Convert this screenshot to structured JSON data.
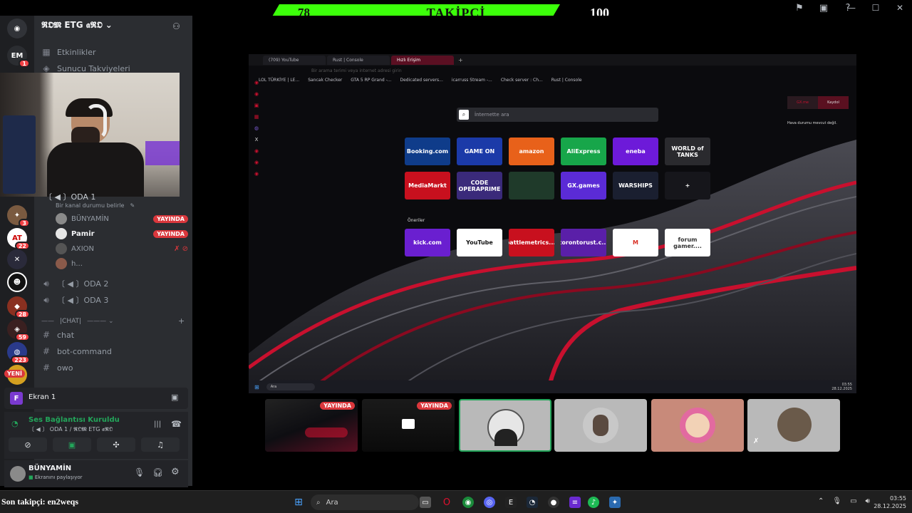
{
  "overlay": {
    "follow_left": "78",
    "follow_title": "TAKİPÇİ",
    "follow_right": "100",
    "last_follower": "Son takipçi: en2weqs"
  },
  "discord": {
    "server_name": "𝕽𝕺𝕸 ETG 𝖆𝕽𝕺",
    "events": "Etkinlikler",
    "boosts": "Sunucu Takviyeleri",
    "voice_room": "〔 ◀ 〕ODA 1",
    "channel_status": "Bir kanal durumu belirle",
    "voice_users": [
      {
        "name": "BÜNYAMİN",
        "live": "YAYINDA"
      },
      {
        "name": "Pamir",
        "live": "YAYINDA"
      },
      {
        "name": "AXION",
        "live": ""
      },
      {
        "name": "h...",
        "live": ""
      }
    ],
    "rooms": [
      "〔 ◀ 〕ODA 2",
      "〔 ◀ 〕ODA 3"
    ],
    "chat_category": "|CHAT|",
    "text_channels": [
      "chat",
      "bot-command",
      "owo"
    ],
    "screen_label": "Ekran 1",
    "voice_status": "Ses Bağlantısı Kuruldu",
    "voice_sub": "〔 ◀ 〕 ODA 1 / 𝕽𝕺𝕸 ETG 𝖆𝕽𝕺",
    "user_name": "BÜNYAMİN",
    "user_status": "Ekranını paylaşıyor",
    "rail_badges": [
      "1",
      "3",
      "22",
      "28",
      "59",
      "223"
    ],
    "rail_new": "YENİ",
    "tile_live": "YAYINDA"
  },
  "browser": {
    "tabs": [
      "(709) YouTube",
      "Rust | Console",
      "Hızlı Erişim"
    ],
    "address_placeholder": "Bir arama terimi veya internet adresi girin",
    "bookmarks": [
      "LOL TÜRKİYE | LE...",
      "Sancak Checker",
      "GTA 5 RP Grand -...",
      "Dedicated servers...",
      "icarruss Stream -...",
      "Check server : Ch...",
      "Rust | Console"
    ],
    "search_placeholder": "İnternette ara",
    "speed_dial": [
      {
        "label": "Booking.com",
        "color": "#0f3c8a"
      },
      {
        "label": "GAME ON",
        "color": "#1b3aa8"
      },
      {
        "label": "amazon",
        "color": "#e8611a"
      },
      {
        "label": "AliExpress",
        "color": "#17a64a"
      },
      {
        "label": "eneba",
        "color": "#6d1ad9"
      },
      {
        "label": "WORLD of TANKS",
        "color": "#2a2a2e"
      },
      {
        "label": "MediaMarkt",
        "color": "#c8101e"
      },
      {
        "label": "CODE OPERAPRIME",
        "color": "#3a2a7a"
      },
      {
        "label": "",
        "color": "#1f3a2a"
      },
      {
        "label": "GX.games",
        "color": "#5b2bd6"
      },
      {
        "label": "WARSHIPS",
        "color": "#1a1f30"
      },
      {
        "label": "+",
        "color": "#16161b"
      }
    ],
    "suggestions_label": "Öneriler",
    "suggestions": [
      {
        "label": "kick.com",
        "color": "#6a1fd0"
      },
      {
        "label": "YouTube",
        "color": "#ffffff"
      },
      {
        "label": "battlemetrics....",
        "color": "#c8101e"
      },
      {
        "label": "torontorust.c...",
        "color": "#5a1fa8"
      },
      {
        "label": "M",
        "color": "#ffffff"
      },
      {
        "label": "forum gamer....",
        "color": "#ffffff"
      }
    ],
    "gx_buttons": [
      "GX.me",
      "Kaydol"
    ],
    "weather": "Hava durumu mevcut değil.",
    "taskbar_search": "Ara",
    "time": "03:55",
    "date": "28.12.2025"
  },
  "taskbar": {
    "search": "Ara",
    "time": "03:55",
    "date": "28.12.2025"
  },
  "colors": {
    "accent": "#3cff0a",
    "live": "#da373c",
    "opera_red": "#c8102e",
    "discord_bg": "#2b2d31"
  }
}
